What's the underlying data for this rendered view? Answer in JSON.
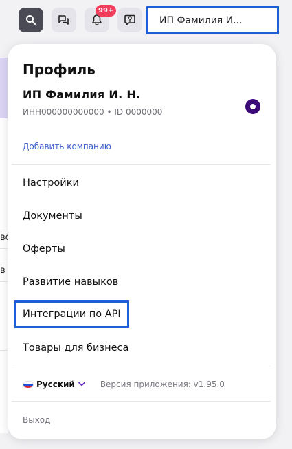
{
  "topbar": {
    "search_icon": "search-icon",
    "chat_icon": "chat-bubbles-icon",
    "bell_icon": "bell-icon",
    "notifications_badge": "99+",
    "feedback_icon": "feedback-icon",
    "account_label": "ИП Фамилия И..."
  },
  "background": {
    "fragment_1": "во",
    "fragment_2": "в"
  },
  "profile": {
    "title": "Профиль",
    "company_name": "ИП Фамилия И. Н.",
    "company_ids": "ИНН000000000000 • ID 0000000",
    "add_company": "Добавить компанию",
    "menu": [
      {
        "label": "Настройки"
      },
      {
        "label": "Документы"
      },
      {
        "label": "Оферты"
      },
      {
        "label": "Развитие навыков"
      },
      {
        "label": "Интеграции по API"
      },
      {
        "label": "Товары для бизнеса"
      }
    ],
    "language": "Русский",
    "version": "Версия приложения: v1.95.0",
    "logout": "Выход"
  },
  "colors": {
    "accent_link": "#3e5fd0",
    "highlight_border": "#1f5fd6",
    "radio_selected": "#3b0a78",
    "badge": "#f23c5a"
  }
}
